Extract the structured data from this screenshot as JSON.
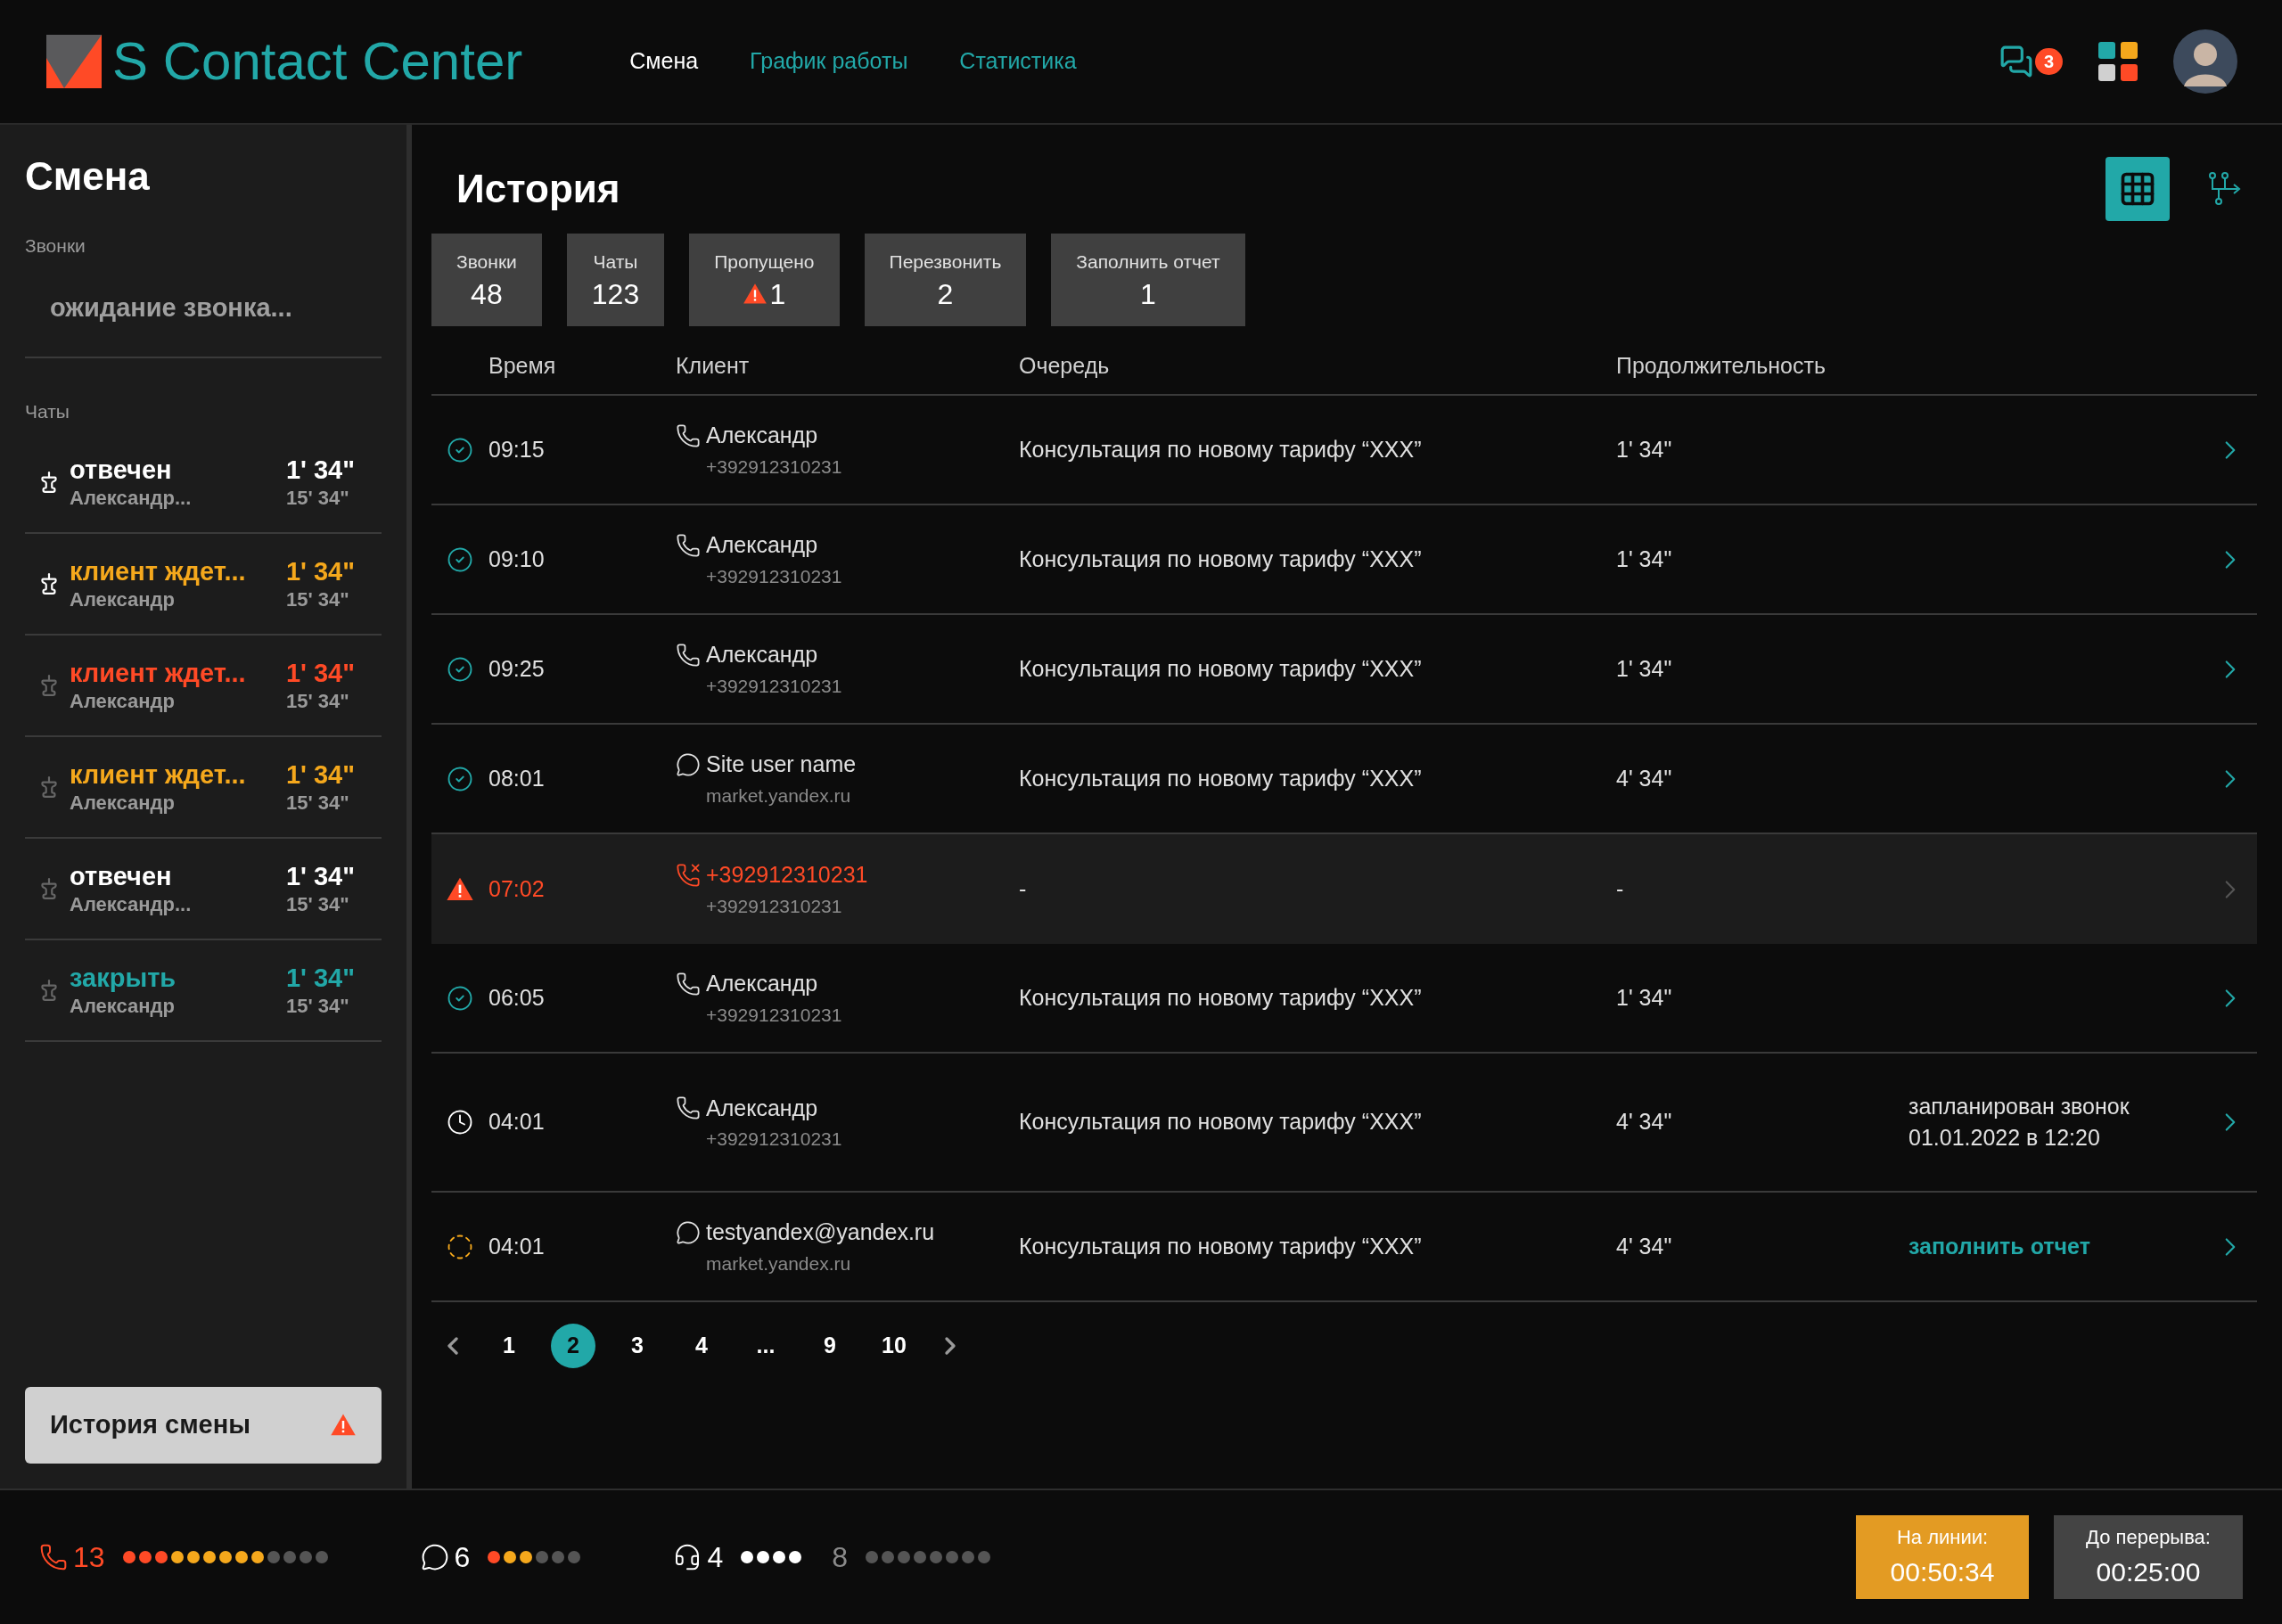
{
  "header": {
    "logo_text": "S Contact Center",
    "nav": [
      {
        "label": "Смена",
        "selected": true
      },
      {
        "label": "График работы",
        "selected": false
      },
      {
        "label": "Статистика",
        "selected": false
      }
    ],
    "chat_badge": "3"
  },
  "sidebar": {
    "title": "Смена",
    "calls_label": "Звонки",
    "calls_status": "ожидание звонка...",
    "chats_label": "Чаты",
    "chats": [
      {
        "status": "отвечен",
        "name": "Александр...",
        "time": "1' 34\"",
        "total": "15' 34\"",
        "color": "#ffffff",
        "pinned": true
      },
      {
        "status": "клиент ждет...",
        "name": "Александр",
        "time": "1' 34\"",
        "total": "15' 34\"",
        "color": "#f5a81c",
        "pinned": true
      },
      {
        "status": "клиент ждет...",
        "name": "Александр",
        "time": "1' 34\"",
        "total": "15' 34\"",
        "color": "#ff4a26",
        "pinned": false
      },
      {
        "status": "клиент ждет...",
        "name": "Александр",
        "time": "1' 34\"",
        "total": "15' 34\"",
        "color": "#f5a81c",
        "pinned": false
      },
      {
        "status": "отвечен",
        "name": "Александр...",
        "time": "1' 34\"",
        "total": "15' 34\"",
        "color": "#ffffff",
        "pinned": false
      },
      {
        "status": "закрыть",
        "name": "Александр",
        "time": "1' 34\"",
        "total": "15' 34\"",
        "color": "#22a8a8",
        "pinned": false
      }
    ],
    "history_button": {
      "label": "История смены",
      "warning": true
    }
  },
  "main": {
    "title": "История",
    "view_buttons": [
      {
        "kind": "table",
        "selected": true
      },
      {
        "kind": "flow",
        "selected": false
      }
    ],
    "stats": [
      {
        "label": "Звонки",
        "value": "48",
        "warning": false
      },
      {
        "label": "Чаты",
        "value": "123",
        "warning": false
      },
      {
        "label": "Пропущено",
        "value": "1",
        "warning": true
      },
      {
        "label": "Перезвонить",
        "value": "2",
        "warning": false
      },
      {
        "label": "Заполнить отчет",
        "value": "1",
        "warning": false
      }
    ],
    "table": {
      "columns": [
        "Время",
        "Клиент",
        "Очередь",
        "Продолжительность"
      ],
      "rows": [
        {
          "kind": "done",
          "time": "09:15",
          "client": {
            "kind": "call",
            "name": "Александр",
            "contact": "+392912310231"
          },
          "queue": "Консультация по новому тарифу “XXX”",
          "duration": "1' 34\""
        },
        {
          "kind": "done",
          "time": "09:10",
          "client": {
            "kind": "call",
            "name": "Александр",
            "contact": "+392912310231"
          },
          "queue": "Консультация по новому тарифу “XXX”",
          "duration": "1' 34\""
        },
        {
          "kind": "done",
          "time": "09:25",
          "client": {
            "kind": "call",
            "name": "Александр",
            "contact": "+392912310231"
          },
          "queue": "Консультация по новому тарифу “XXX”",
          "duration": "1' 34\""
        },
        {
          "kind": "done",
          "time": "08:01",
          "client": {
            "kind": "chat",
            "name": "Site user name",
            "contact": "market.yandex.ru"
          },
          "queue": "Консультация по новому тарифу “XXX”",
          "duration": "4' 34\""
        },
        {
          "kind": "missed",
          "time": "07:02",
          "client": {
            "kind": "missed_call",
            "name": "+392912310231",
            "contact": "+392912310231"
          },
          "queue": "-",
          "duration": "-"
        },
        {
          "kind": "done",
          "time": "06:05",
          "client": {
            "kind": "call",
            "name": "Александр",
            "contact": "+392912310231"
          },
          "queue": "Консультация по новому тарифу “XXX”",
          "duration": "1' 34\""
        },
        {
          "kind": "scheduled",
          "time": "04:01",
          "client": {
            "kind": "call",
            "name": "Александр",
            "contact": "+392912310231"
          },
          "queue": "Консультация по новому тарифу “XXX”",
          "duration": "4' 34\"",
          "note": {
            "kind": "text",
            "text": "запланирован звонок 01.01.2022 в 12:20"
          }
        },
        {
          "kind": "pending",
          "time": "04:01",
          "client": {
            "kind": "chat",
            "name": "testyandex@yandex.ru",
            "contact": "market.yandex.ru"
          },
          "queue": "Консультация по новому тарифу “XXX”",
          "duration": "4' 34\"",
          "note": {
            "kind": "link",
            "text": "заполнить отчет"
          }
        }
      ]
    },
    "pagination": {
      "pages": [
        {
          "label": "1",
          "selected": false
        },
        {
          "label": "2",
          "selected": true
        },
        {
          "label": "3",
          "selected": false
        },
        {
          "label": "4",
          "selected": false
        },
        {
          "label": "...",
          "selected": false
        },
        {
          "label": "9",
          "selected": false
        },
        {
          "label": "10",
          "selected": false
        }
      ]
    }
  },
  "footer": {
    "groups": [
      {
        "kind": "calls",
        "count": "13",
        "dots": [
          {
            "color": "#ff4a26"
          },
          {
            "color": "#ff4a26"
          },
          {
            "color": "#ff4a26"
          },
          {
            "color": "#f5a81c"
          },
          {
            "color": "#f5a81c"
          },
          {
            "color": "#f5a81c"
          },
          {
            "color": "#f5a81c"
          },
          {
            "color": "#f5a81c"
          },
          {
            "color": "#f5a81c"
          },
          {
            "color": "#555555"
          },
          {
            "color": "#555555"
          },
          {
            "color": "#555555"
          },
          {
            "color": "#555555"
          }
        ]
      },
      {
        "kind": "chats",
        "count": "6",
        "dots": [
          {
            "color": "#ff4a26"
          },
          {
            "color": "#f5a81c"
          },
          {
            "color": "#f5a81c"
          },
          {
            "color": "#555555"
          },
          {
            "color": "#555555"
          },
          {
            "color": "#555555"
          }
        ]
      },
      {
        "kind": "operators",
        "count": "4",
        "dots": [
          {
            "color": "#ffffff"
          },
          {
            "color": "#ffffff"
          },
          {
            "color": "#ffffff"
          },
          {
            "color": "#ffffff"
          }
        ]
      },
      {
        "kind": "idle",
        "count": "8",
        "dots": [
          {
            "color": "#555555"
          },
          {
            "color": "#555555"
          },
          {
            "color": "#555555"
          },
          {
            "color": "#555555"
          },
          {
            "color": "#555555"
          },
          {
            "color": "#555555"
          },
          {
            "color": "#555555"
          },
          {
            "color": "#555555"
          }
        ]
      }
    ],
    "timers": [
      {
        "kind": "active",
        "label": "На линии:",
        "value": "00:50:34"
      },
      {
        "kind": "break",
        "label": "До перерыва:",
        "value": "00:25:00"
      }
    ]
  }
}
